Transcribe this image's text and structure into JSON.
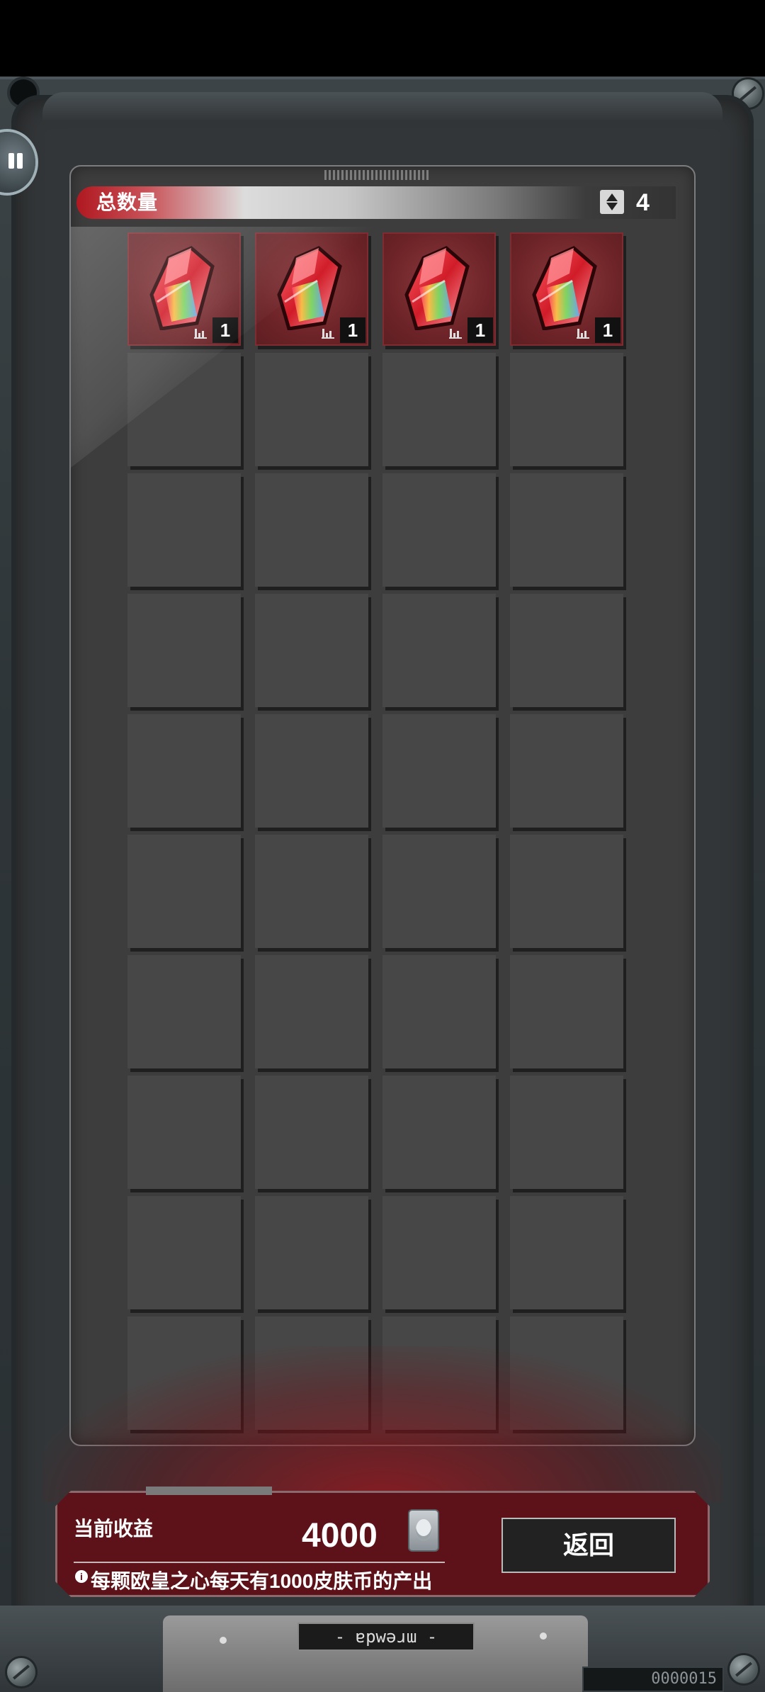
{
  "header": {
    "title": "总数量",
    "count": "4"
  },
  "grid": {
    "columns": 4,
    "rows": 10,
    "items": [
      {
        "name": "欧皇之心",
        "count": "1"
      },
      {
        "name": "欧皇之心",
        "count": "1"
      },
      {
        "name": "欧皇之心",
        "count": "1"
      },
      {
        "name": "欧皇之心",
        "count": "1"
      }
    ]
  },
  "earnings": {
    "label": "当前收益",
    "value": "4000",
    "info_text": "每颗欧皇之心每天有1000皮肤币的产出"
  },
  "buttons": {
    "return_label": "返回"
  },
  "device": {
    "plate_label": "- ɐpwǝɹɯ -",
    "code": "0000015"
  },
  "colors": {
    "accent_red": "#b01820",
    "slot_filled": "#6e2428",
    "slot_empty": "#474747"
  }
}
